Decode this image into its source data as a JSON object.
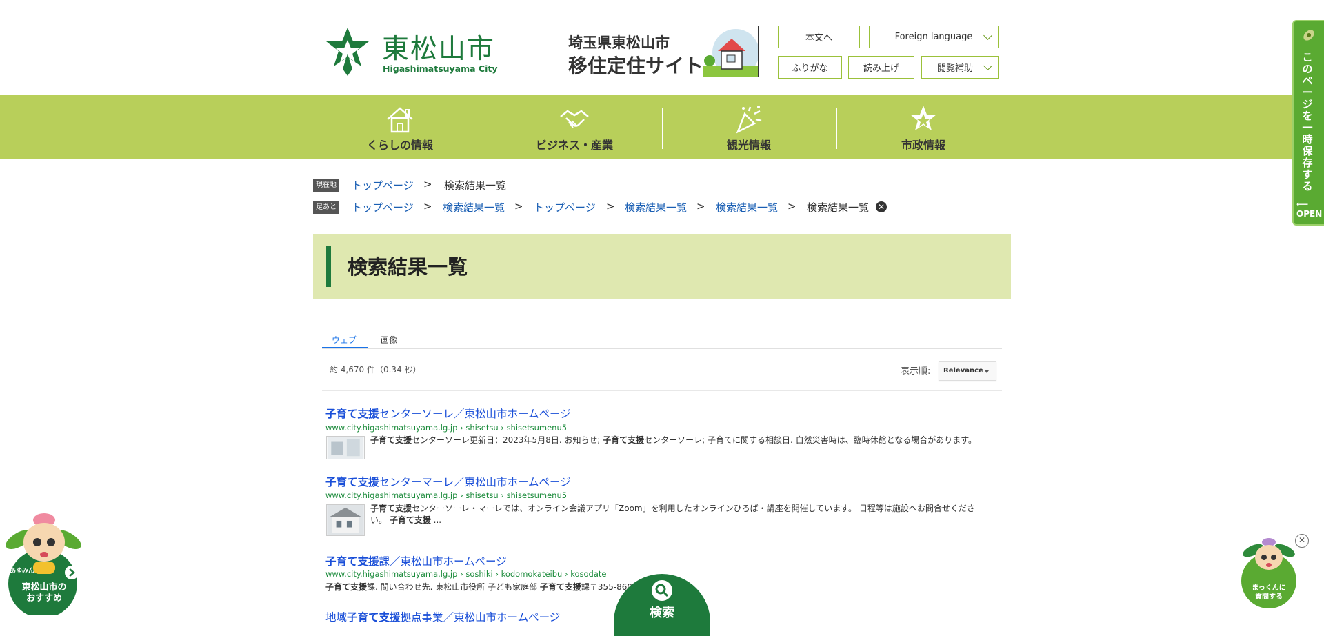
{
  "header": {
    "logo_ja": "東松山市",
    "logo_en": "Higashimatsuyama City",
    "banner_line1": "埼玉県東松山市",
    "banner_line2": "移住定住サイト",
    "btn_main": "本文へ",
    "btn_foreign": "Foreign language",
    "btn_furigana": "ふりがな",
    "btn_read": "読み上げ",
    "btn_assist": "閲覧補助"
  },
  "nav": {
    "items": [
      {
        "label": "くらしの情報",
        "icon": "house-icon"
      },
      {
        "label": "ビジネス・産業",
        "icon": "handshake-icon"
      },
      {
        "label": "観光情報",
        "icon": "party-popper-icon"
      },
      {
        "label": "市政情報",
        "icon": "city-emblem-icon"
      }
    ]
  },
  "breadcrumb": {
    "current_tag": "現在地",
    "current": [
      "トップページ",
      "検索結果一覧"
    ],
    "history_tag": "足あと",
    "history": [
      "トップページ",
      "検索結果一覧",
      "トップページ",
      "検索結果一覧",
      "検索結果一覧",
      "検索結果一覧"
    ],
    "sep": ">"
  },
  "page_title": "検索結果一覧",
  "search": {
    "tabs": [
      "ウェブ",
      "画像"
    ],
    "count": "約 4,670 件（0.34 秒）",
    "sort_label": "表示順:",
    "sort_value": "Relevance",
    "results": [
      {
        "title_bold": "子育て支援",
        "title_rest": "センターソーレ／東松山市ホームページ",
        "url": "www.city.higashimatsuyama.lg.jp › shisetsu › shisetsumenu5",
        "snippet_bold1": "子育て支援",
        "snippet1": "センターソーレ更新日：2023年5月8日. お知らせ; ",
        "snippet_bold2": "子育て支援",
        "snippet2": "センターソーレ; 子育てに関する相談日. 自然災害時は、臨時休館となる場合があります。"
      },
      {
        "title_bold": "子育て支援",
        "title_rest": "センターマーレ／東松山市ホームページ",
        "url": "www.city.higashimatsuyama.lg.jp › shisetsu › shisetsumenu5",
        "snippet_bold1": "子育て支援",
        "snippet1": "センターソーレ・マーレでは、オンライン会議アプリ「Zoom」を利用したオンラインひろば・講座を開催しています。 日程等は施設へお問合せください。 ",
        "snippet_bold2": "子育て支援",
        "snippet2": " ..."
      },
      {
        "title_bold": "子育て支援",
        "title_rest": "課／東松山市ホームページ",
        "url": "www.city.higashimatsuyama.lg.jp › soshiki › kodomokateibu › kosodate",
        "snippet_bold1": "子育て支援",
        "snippet1": "課. 問い合わせ先. 東松山市役所 子ども家庭部 ",
        "snippet_bold2": "子育て支援",
        "snippet2": "課〒355-860… 1-1 ..."
      },
      {
        "title_pre": "地域",
        "title_bold": "子育て支援",
        "title_rest": "拠点事業／東松山市ホームページ"
      }
    ]
  },
  "side_tab": {
    "text": "このページを一時保存する",
    "open": "OPEN"
  },
  "mascot_left": {
    "name_small": "あゆみん",
    "line1": "東松山市の",
    "line2": "おすすめ"
  },
  "mascot_right": {
    "line1": "まっくんに",
    "line2": "質問する"
  },
  "search_fab": "検索",
  "colors": {
    "brand_green": "#1e7a3c",
    "nav_green": "#b8cf5a",
    "title_bg": "#dfe8b0",
    "link_blue": "#1a4fd8",
    "url_green": "#1a8a3a"
  }
}
